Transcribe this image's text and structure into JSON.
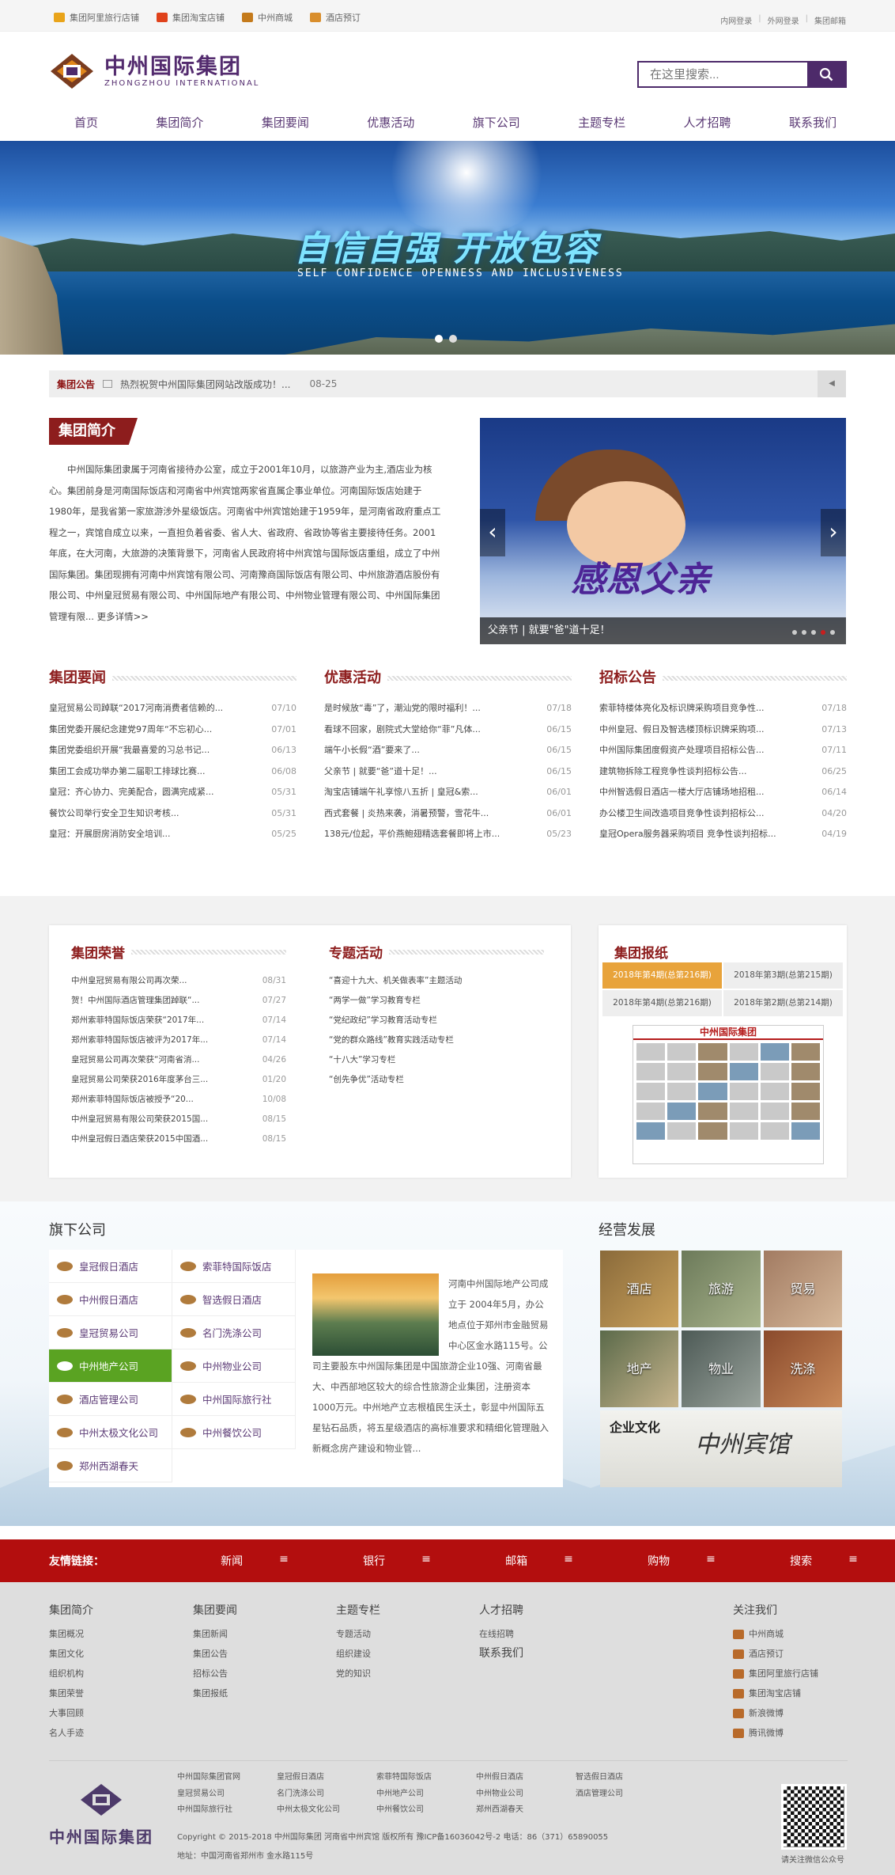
{
  "topbar": {
    "links": [
      "集团阿里旅行店铺",
      "集团淘宝店铺",
      "中州商城",
      "酒店预订"
    ],
    "login": [
      "内网登录",
      "外网登录",
      "集团邮箱"
    ]
  },
  "header": {
    "logo_cn": "中州国际集团",
    "logo_en": "ZHONGZHOU   INTERNATIONAL",
    "search_placeholder": "在这里搜索..."
  },
  "nav": [
    "首页",
    "集团简介",
    "集团要闻",
    "优惠活动",
    "旗下公司",
    "主题专栏",
    "人才招聘",
    "联系我们"
  ],
  "banner": {
    "slogan": "自信自强  开放包容",
    "slogan_en": "SELF CONFIDENCE OPENNESS AND INCLUSIVENESS"
  },
  "notice": {
    "label": "集团公告",
    "text": "热烈祝贺中州国际集团网站改版成功！...",
    "date": "08-25"
  },
  "intro": {
    "title": "集团简介",
    "text": "中州国际集团隶属于河南省接待办公室，成立于2001年10月，以旅游产业为主,酒店业为核心。集团前身是河南国际饭店和河南省中州宾馆两家省直属企事业单位。河南国际饭店始建于1980年，是我省第一家旅游涉外星级饭店。河南省中州宾馆始建于1959年，是河南省政府重点工程之一，宾馆自成立以来，一直担负着省委、省人大、省政府、省政协等省主要接待任务。2001年底，在大河南，大旅游的决策背景下，河南省人民政府将中州宾馆与国际饭店重组，成立了中州国际集团。集团现拥有河南中州宾馆有限公司、河南豫商国际饭店有限公司、中州旅游酒店股份有限公司、中州皇冠贸易有限公司、中州国际地产有限公司、中州物业管理有限公司、中州国际集团管理有限... ",
    "more": "更多详情>>"
  },
  "slide": {
    "caption": "父亲节 | 就要\"爸\"道十足！",
    "title": "感恩父亲"
  },
  "news": {
    "title": "集团要闻",
    "items": [
      {
        "t": "皇冠贸易公司踔联“2017河南消费者信赖的...",
        "d": "07/10"
      },
      {
        "t": "集团党委开展纪念建党97周年“不忘初心...",
        "d": "07/01"
      },
      {
        "t": "集团党委组织开展“我最喜爱的习总书记...",
        "d": "06/13"
      },
      {
        "t": "集团工会成功举办第二届职工排球比赛...",
        "d": "06/08"
      },
      {
        "t": "皇冠：齐心协力、完美配合，圆满完成紧...",
        "d": "05/31"
      },
      {
        "t": "餐饮公司举行安全卫生知识考核...",
        "d": "05/31"
      },
      {
        "t": "皇冠：开展厨房消防安全培训...",
        "d": "05/25"
      }
    ]
  },
  "promo": {
    "title": "优惠活动",
    "items": [
      {
        "t": "是时候放“毒”了，潮汕党的限时福利！...",
        "d": "07/18"
      },
      {
        "t": "看球不回家，剧院式大堂给你“菲”凡体...",
        "d": "06/15"
      },
      {
        "t": "端午小长假“酒”要来了...",
        "d": "06/15"
      },
      {
        "t": "父亲节 | 就要“爸”道十足！...",
        "d": "06/15"
      },
      {
        "t": "淘宝店铺端午礼享惊八五折 | 皇冠&索...",
        "d": "06/01"
      },
      {
        "t": "西式套餐 | 炎热来袭，消暑预警，雪花牛...",
        "d": "06/01"
      },
      {
        "t": "138元/位起，平价燕鲍翅精选套餐即将上市...",
        "d": "05/23"
      }
    ]
  },
  "bids": {
    "title": "招标公告",
    "items": [
      {
        "t": "索菲特楼体亮化及标识牌采购项目竞争性...",
        "d": "07/18"
      },
      {
        "t": "中州皇冠、假日及智选楼顶标识牌采购项...",
        "d": "07/13"
      },
      {
        "t": "中州国际集团度假资产处理项目招标公告...",
        "d": "07/11"
      },
      {
        "t": "建筑物拆除工程竞争性谈判招标公告...",
        "d": "06/25"
      },
      {
        "t": "中州智选假日酒店一楼大厅店铺场地招租...",
        "d": "06/14"
      },
      {
        "t": "办公楼卫生间改造项目竞争性谈判招标公...",
        "d": "04/20"
      },
      {
        "t": "皇冠Opera服务器采购项目 竞争性谈判招标...",
        "d": "04/19"
      }
    ]
  },
  "honor": {
    "title": "集团荣誉",
    "items": [
      {
        "t": "中州皇冠贸易有限公司再次荣...",
        "d": "08/31"
      },
      {
        "t": "贺！中州国际酒店管理集团踔联“...",
        "d": "07/27"
      },
      {
        "t": "郑州索菲特国际饭店荣获“2017年...",
        "d": "07/14"
      },
      {
        "t": "郑州索菲特国际饭店被评为2017年...",
        "d": "07/14"
      },
      {
        "t": "皇冠贸易公司再次荣获“河南省消...",
        "d": "04/26"
      },
      {
        "t": "皇冠贸易公司荣获2016年度茅台三...",
        "d": "01/20"
      },
      {
        "t": "郑州索菲特国际饭店被授予“20...",
        "d": "10/08"
      },
      {
        "t": "中州皇冠贸易有限公司荣获2015国...",
        "d": "08/15"
      },
      {
        "t": "中州皇冠假日酒店荣获2015中国酒...",
        "d": "08/15"
      }
    ]
  },
  "special": {
    "title": "专题活动",
    "items": [
      "“喜迎十九大、机关做表率”主题活动",
      "“两学一做”学习教育专栏",
      "“党纪政纪”学习教育活动专栏",
      "“党的群众路线”教育实践活动专栏",
      "“十八大”学习专栏",
      "“创先争优”活动专栏"
    ]
  },
  "paper": {
    "title": "集团报纸",
    "tabs": [
      "2018年第4期(总第216期)",
      "2018年第3期(总第215期)",
      "2018年第4期(总第216期)",
      "2018年第2期(总第214期)"
    ],
    "masthead": "中州国际集团"
  },
  "companies": {
    "title": "旗下公司",
    "items": [
      "皇冠假日酒店",
      "索菲特国际饭店",
      "中州假日酒店",
      "智选假日酒店",
      "皇冠贸易公司",
      "名门洗涤公司",
      "中州地产公司",
      "中州物业公司",
      "酒店管理公司",
      "中州国际旅行社",
      "中州太极文化公司",
      "中州餐饮公司",
      "郑州西湖春天"
    ],
    "active": "中州地产公司",
    "desc": "河南中州国际地产公司成立于 2004年5月，办公地点位于郑州市金融贸易中心区金水路115号。公司主要股东中州国际集团是中国旅游企业10强、河南省最大、中西部地区较大的综合性旅游企业集团，注册资本1000万元。中州地产立志根植民生沃土，彰显中州国际五星钻石品质，将五星级酒店的高标准要求和精细化管理融入新概念房产建设和物业管..."
  },
  "development": {
    "title": "经营发展",
    "tiles": [
      "酒店",
      "旅游",
      "贸易",
      "地产",
      "物业",
      "洗涤"
    ],
    "culture": "企业文化",
    "calligraphy": "中州宾馆"
  },
  "links_bar": {
    "label": "友情链接：",
    "items": [
      "新闻",
      "银行",
      "邮箱",
      "购物",
      "搜索"
    ],
    "icon": "≡"
  },
  "footer": {
    "cols": [
      {
        "title": "集团简介",
        "items": [
          "集团概况",
          "集团文化",
          "组织机构",
          "集团荣誉",
          "大事回顾",
          "名人手迹"
        ]
      },
      {
        "title": "集团要闻",
        "items": [
          "集团新闻",
          "集团公告",
          "招标公告",
          "集团报纸"
        ]
      },
      {
        "title": "主题专栏",
        "items": [
          "专题活动",
          "组织建设",
          "党的知识"
        ]
      },
      {
        "title": "人才招聘",
        "items": [
          "在线招聘"
        ],
        "extra": "联系我们"
      },
      {
        "title": "关注我们",
        "items": [
          "中州商城",
          "酒店预订",
          "集团阿里旅行店铺",
          "集团淘宝店铺",
          "新浪微博",
          "腾讯微博"
        ]
      }
    ],
    "logo": "中州国际集团",
    "links": [
      "中州国际集团官网",
      "皇冠假日酒店",
      "索菲特国际饭店",
      "中州假日酒店",
      "智选假日酒店",
      "皇冠贸易公司",
      "名门洗涤公司",
      "中州地产公司",
      "中州物业公司",
      "酒店管理公司",
      "中州国际旅行社",
      "中州太极文化公司",
      "中州餐饮公司",
      "郑州西湖春天",
      ""
    ],
    "copyright": "Copyright © 2015-2018 中州国际集团 河南省中州宾馆 版权所有 豫ICP备16036042号-2 电话：86（371）65890055",
    "address": "地址：中国河南省郑州市 金水路115号",
    "qr_caption": "请关注微信公众号"
  }
}
